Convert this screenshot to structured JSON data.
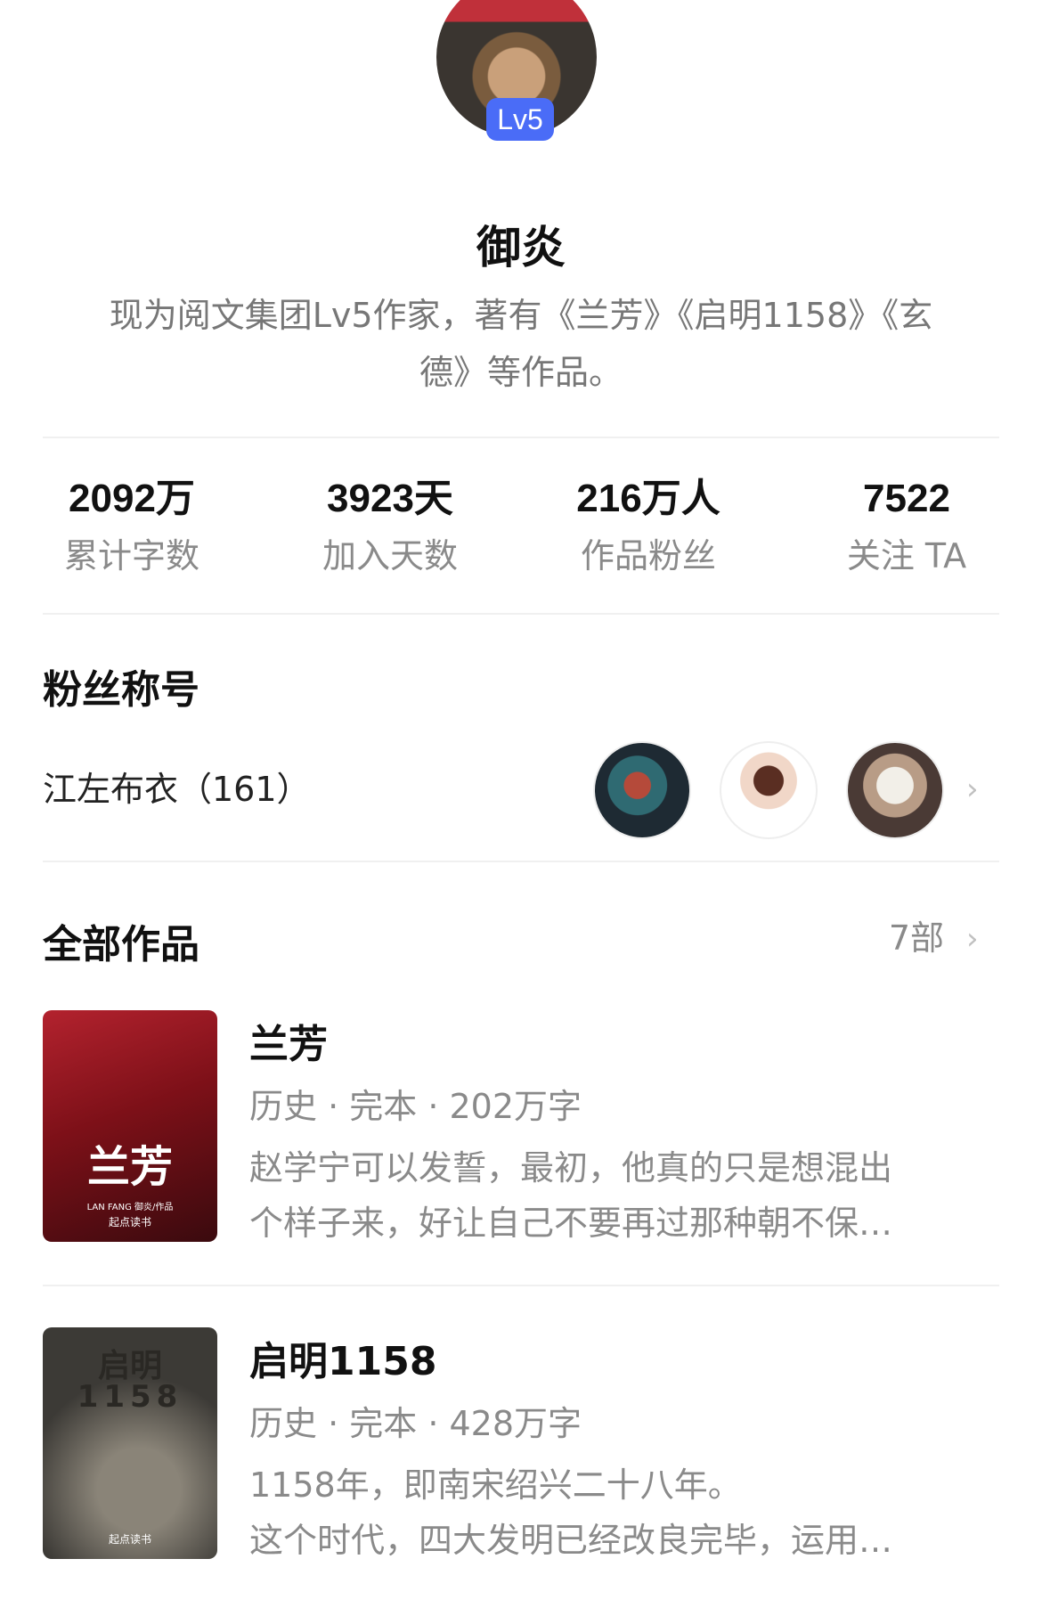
{
  "profile": {
    "level_badge": "Lv5",
    "name": "御炎",
    "bio_line1": "现为阅文集团Lv5作家，著有《兰芳》《启明1158》《玄",
    "bio_line2": "德》等作品。"
  },
  "stats": [
    {
      "value": "2092万",
      "label": "累计字数"
    },
    {
      "value": "3923天",
      "label": "加入天数"
    },
    {
      "value": "216万人",
      "label": "作品粉丝"
    },
    {
      "value": "7522",
      "label": "关注 TA"
    }
  ],
  "fan_title": {
    "heading": "粉丝称号",
    "name": "江左布衣（161）",
    "chevron": "›"
  },
  "works": {
    "heading": "全部作品",
    "count": "7部",
    "chevron": "›",
    "books": [
      {
        "title": "兰芳",
        "meta": "历史 · 完本 · 202万字",
        "desc_line1": "赵学宁可以发誓，最初，他真的只是想混出",
        "desc_line2": "个样子来，好让自己不要再过那种朝不保…",
        "cover_title": "兰芳",
        "cover_sub": "LAN FANG 御炎/作品",
        "cover_publisher": "起点读书"
      },
      {
        "title": "启明1158",
        "meta": "历史 · 完本 · 428万字",
        "desc_line1": "1158年，即南宋绍兴二十八年。",
        "desc_line2": "这个时代，四大发明已经改良完毕，运用…",
        "cover_title": "启明",
        "cover_sub": "1158",
        "cover_publisher": "起点读书"
      }
    ]
  },
  "colors": {
    "level_badge": "#4a6cf7",
    "text_primary": "#111111",
    "text_secondary": "#8a8a8a",
    "divider": "#f0f0f0"
  }
}
